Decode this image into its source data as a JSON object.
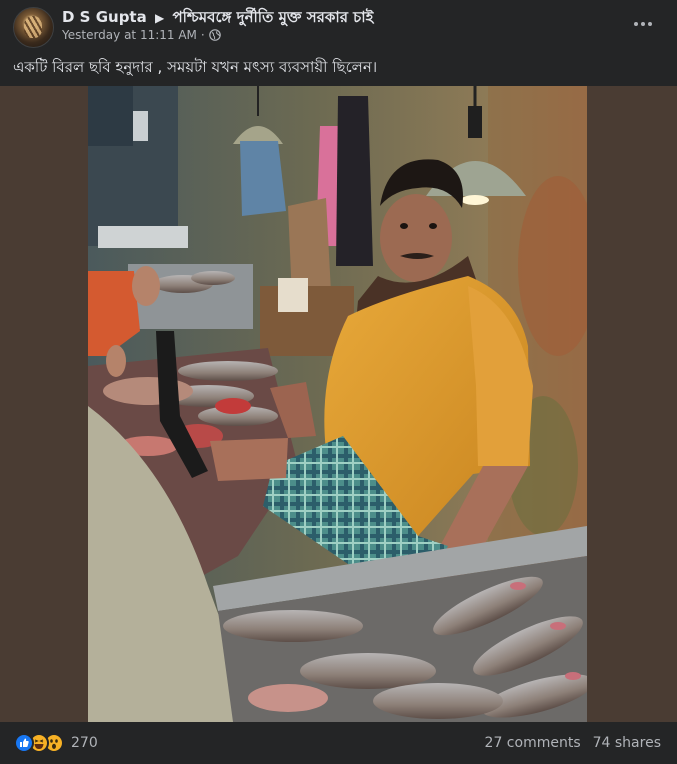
{
  "post": {
    "author": "D S Gupta",
    "group": "পশ্চিমবঙ্গে দুর্নীতি মুক্ত সরকার চাই",
    "timestamp": "Yesterday at 11:11 AM",
    "separator": "·",
    "audience_icon": "globe-icon",
    "caption": "একটি বিরল ছবি হনুদার , সময়টা  যখন মৎস্য ব্যবসায়ী ছিলেন।"
  },
  "reactions": {
    "icons": [
      "like-icon",
      "haha-icon",
      "wow-icon"
    ],
    "count": "270"
  },
  "stats": {
    "comments": "27 comments",
    "shares": "74 shares"
  },
  "colors": {
    "background": "#242526",
    "text_primary": "#e4e6eb",
    "text_secondary": "#b0b3b8",
    "like_blue": "#1877f2",
    "emoji_yellow": "#f7b125"
  }
}
